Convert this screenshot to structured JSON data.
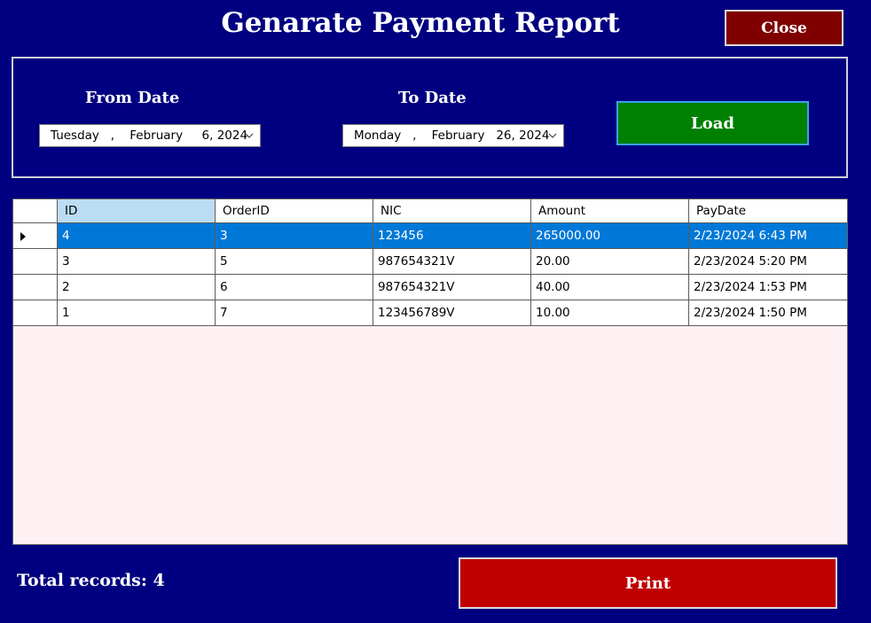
{
  "window": {
    "title": "Genarate Payment Report"
  },
  "toolbar": {
    "close_label": "Close"
  },
  "filter": {
    "from_label": "From Date",
    "from_value": "Tuesday   ,    February     6, 2024",
    "to_label": "To Date",
    "to_value": "Monday   ,    February   26, 2024",
    "load_label": "Load"
  },
  "grid": {
    "columns": [
      "ID",
      "OrderID",
      "NIC",
      "Amount",
      "PayDate"
    ],
    "selected_row": 0,
    "rows": [
      [
        "4",
        "3",
        "123456",
        "265000.00",
        "2/23/2024 6:43 PM"
      ],
      [
        "3",
        "5",
        "987654321V",
        "20.00",
        "2/23/2024 5:20 PM"
      ],
      [
        "2",
        "6",
        "987654321V",
        "40.00",
        "2/23/2024 1:53 PM"
      ],
      [
        "1",
        "7",
        "123456789V",
        "10.00",
        "2/23/2024 1:50 PM"
      ]
    ]
  },
  "footer": {
    "total_label": "Total records: 4",
    "print_label": "Print"
  },
  "colors": {
    "background": "#000080",
    "close": "#800000",
    "load": "#008000",
    "print": "#c00000",
    "selection": "#0078d7"
  }
}
